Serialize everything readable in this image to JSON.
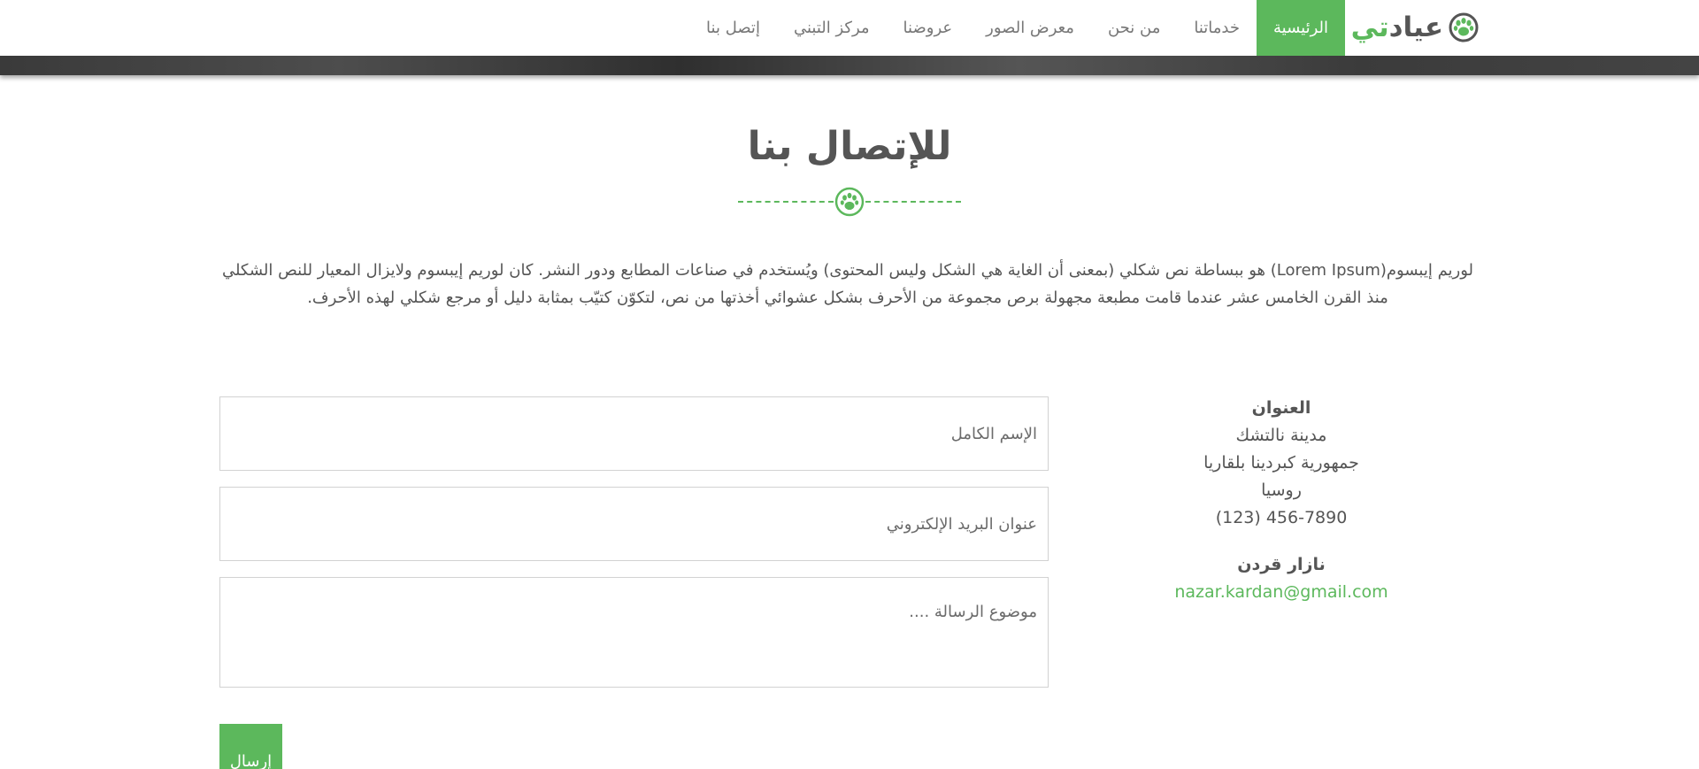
{
  "brand": {
    "part1": "عياد",
    "part2": "تي"
  },
  "nav": {
    "items": [
      {
        "label": "الرئيسية",
        "active": true
      },
      {
        "label": "خدماتنا"
      },
      {
        "label": "من نحن"
      },
      {
        "label": "معرض الصور"
      },
      {
        "label": "عروضنا"
      },
      {
        "label": "مركز التبني"
      },
      {
        "label": "إتصل بنا"
      }
    ]
  },
  "section": {
    "title": "للإتصال بنا",
    "intro": "لوريم إيبسوم(Lorem Ipsum) هو ببساطة نص شكلي (بمعنى أن الغاية هي الشكل وليس المحتوى) ويُستخدم في صناعات المطابع ودور النشر. كان لوريم إيبسوم ولايزال المعيار للنص الشكلي منذ القرن الخامس عشر عندما قامت مطبعة مجهولة برص مجموعة من الأحرف بشكل عشوائي أخذتها من نص، لتكوّن كتيّب بمثابة دليل أو مرجع شكلي لهذه الأحرف."
  },
  "contact": {
    "address_heading": "العنوان",
    "address_line1": "مدينة نالتشك",
    "address_line2": "جمهورية كبردينا بلقاريا",
    "address_line3": "روسيا",
    "phone": "(123) 456-7890",
    "person_name": "نازار قردن",
    "email": "nazar.kardan@gmail.com"
  },
  "form": {
    "name_placeholder": "الإسم الكامل",
    "email_placeholder": "عنوان البريد الإلكتروني",
    "message_placeholder": "موضوع الرسالة ....",
    "submit_label": "إرسال"
  },
  "colors": {
    "accent": "#5cb85c",
    "text": "#555555",
    "nav_text": "#777777"
  },
  "icons": {
    "brand": "paw-icon",
    "divider": "paw-icon"
  }
}
